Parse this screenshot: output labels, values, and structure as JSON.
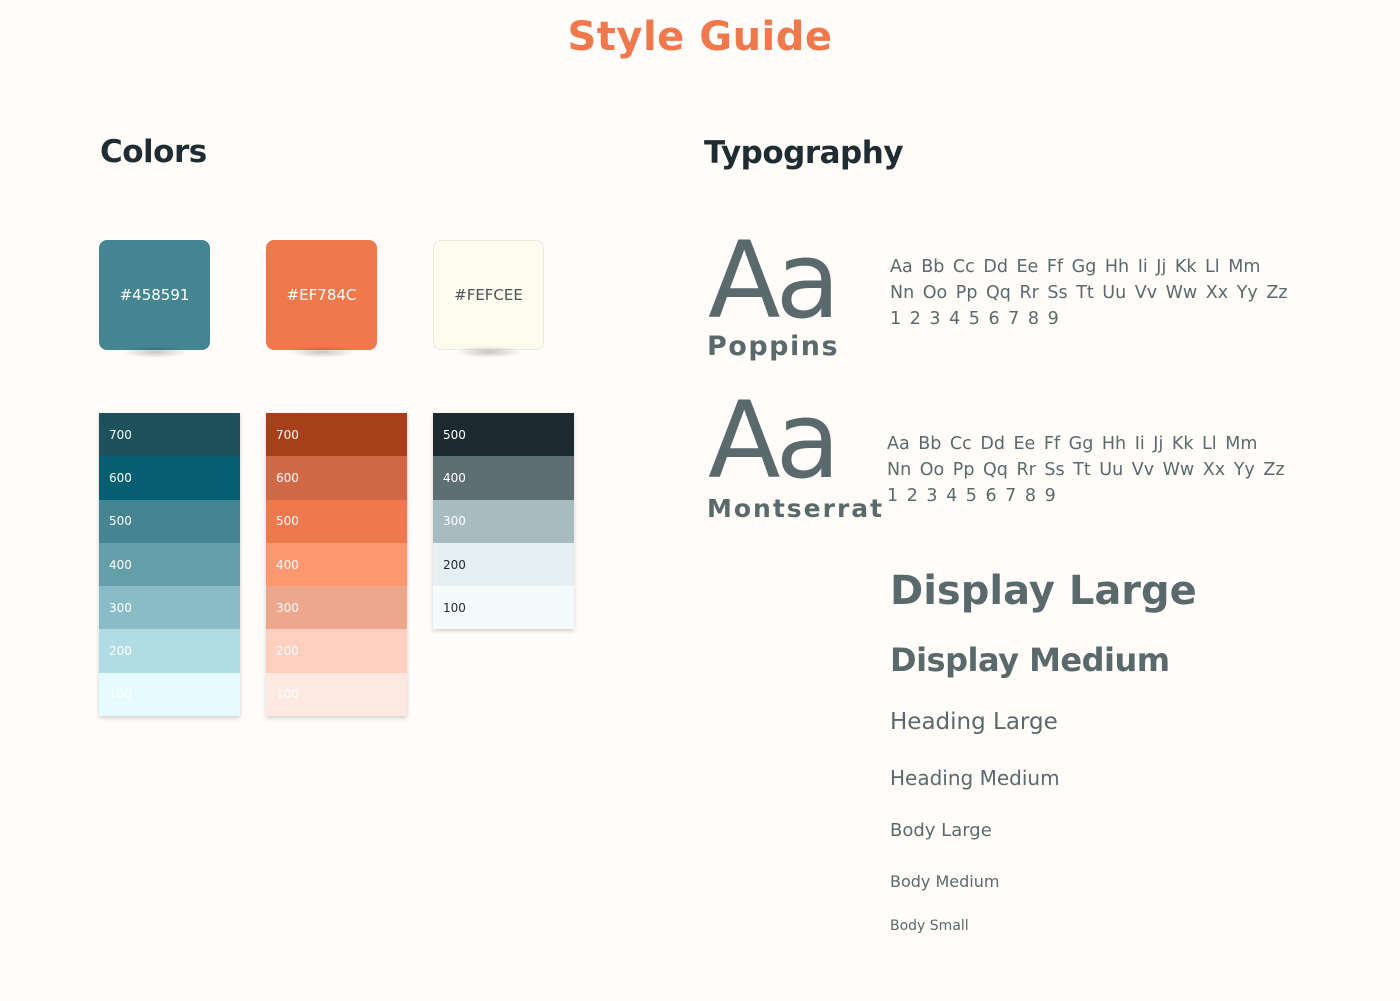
{
  "page": {
    "title": "Style Guide"
  },
  "colors": {
    "heading": "Colors",
    "swatches": [
      {
        "label": "#458591",
        "color": "#458591",
        "text_color": "#ffffff"
      },
      {
        "label": "#EF784C",
        "color": "#EF784C",
        "text_color": "#ffffff"
      },
      {
        "label": "#FEFCEE",
        "color": "#FEFCEE",
        "text_color": "#4a5456"
      }
    ],
    "palettes": [
      {
        "name": "teal",
        "shades": [
          {
            "label": "700",
            "color": "#1d525c",
            "text": "#ffffff"
          },
          {
            "label": "600",
            "color": "#055f71",
            "text": "#ffffff"
          },
          {
            "label": "500",
            "color": "#458591",
            "text": "#ffffff"
          },
          {
            "label": "400",
            "color": "#639ea9",
            "text": "#ffffff"
          },
          {
            "label": "300",
            "color": "#89bcc6",
            "text": "#ffffff"
          },
          {
            "label": "200",
            "color": "#b2dce4",
            "text": "#ffffff"
          },
          {
            "label": "100",
            "color": "#e5fbff",
            "text": "#ffffff"
          }
        ]
      },
      {
        "name": "orange",
        "shades": [
          {
            "label": "700",
            "color": "#a63f1a",
            "text": "#ffffff"
          },
          {
            "label": "600",
            "color": "#d26946",
            "text": "#ffffff"
          },
          {
            "label": "500",
            "color": "#ef784c",
            "text": "#ffffff"
          },
          {
            "label": "400",
            "color": "#ff9770",
            "text": "#ffffff"
          },
          {
            "label": "300",
            "color": "#eca78d",
            "text": "#ffffff"
          },
          {
            "label": "200",
            "color": "#ffd0c0",
            "text": "#ffffff"
          },
          {
            "label": "100",
            "color": "#ffe8e1",
            "text": "#ffffff"
          }
        ]
      },
      {
        "name": "neutral",
        "shades": [
          {
            "label": "500",
            "color": "#1c2a2f",
            "text": "#ffffff"
          },
          {
            "label": "400",
            "color": "#5e6e72",
            "text": "#ffffff"
          },
          {
            "label": "300",
            "color": "#a7bbc0",
            "text": "#ffffff"
          },
          {
            "label": "200",
            "color": "#e6eff2",
            "text": "#1c2a2f"
          },
          {
            "label": "100",
            "color": "#f5fbfd",
            "text": "#1c2a2f"
          }
        ]
      }
    ]
  },
  "typography": {
    "heading": "Typography",
    "fonts": [
      {
        "sample": "Aa",
        "name": "Poppins",
        "glyph_lines": [
          "Aa Bb Cc Dd Ee Ff Gg Hh Ii Jj Kk Ll Mm",
          "Nn Oo Pp Qq Rr Ss Tt Uu Vv Ww Xx Yy Zz",
          "1 2 3 4 5 6 7 8 9"
        ]
      },
      {
        "sample": "Aa",
        "name": "Montserrat",
        "glyph_lines": [
          "Aa Bb Cc Dd Ee Ff Gg Hh Ii Jj Kk Ll Mm",
          "Nn Oo Pp Qq Rr Ss Tt Uu Vv Ww Xx Yy Zz",
          "1 2 3 4 5 6 7 8 9"
        ]
      }
    ],
    "scale": {
      "display_large": "Display Large",
      "display_medium": "Display Medium",
      "heading_large": "Heading Large",
      "heading_medium": "Heading Medium",
      "body_large": "Body Large",
      "body_medium": "Body Medium",
      "body_small": "Body Small"
    }
  }
}
